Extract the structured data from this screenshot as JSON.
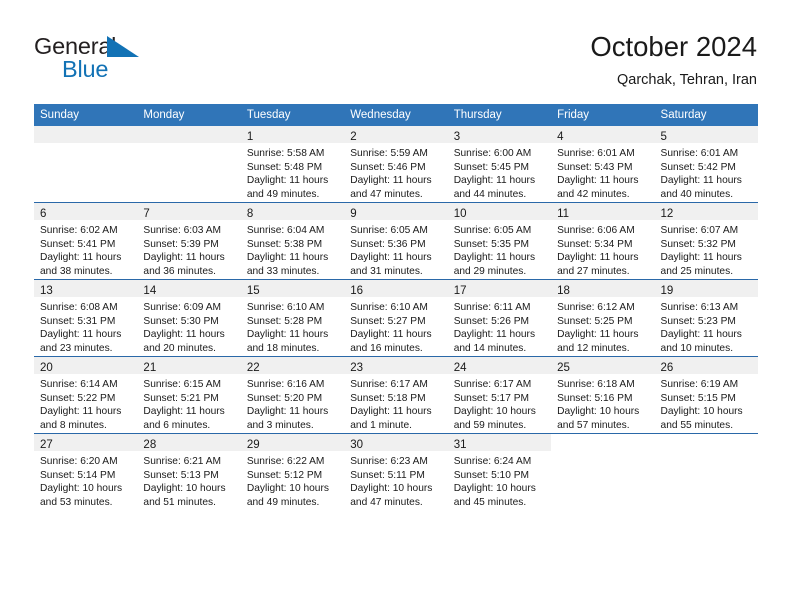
{
  "brand": {
    "name_top": "General",
    "name_bottom": "Blue",
    "accent_color": "#1272b5"
  },
  "header": {
    "title": "October 2024",
    "location": "Qarchak, Tehran, Iran"
  },
  "theme": {
    "header_blue": "#3075b8",
    "rule_blue": "#2a68a8",
    "daynum_strip": "#f0f0f0"
  },
  "calendar": {
    "weekday_headers": [
      "Sunday",
      "Monday",
      "Tuesday",
      "Wednesday",
      "Thursday",
      "Friday",
      "Saturday"
    ],
    "weeks": [
      [
        {
          "day": "",
          "lines": [],
          "empty": true
        },
        {
          "day": "",
          "lines": [],
          "empty": true
        },
        {
          "day": "1",
          "lines": [
            "Sunrise: 5:58 AM",
            "Sunset: 5:48 PM",
            "Daylight: 11 hours",
            "and 49 minutes."
          ]
        },
        {
          "day": "2",
          "lines": [
            "Sunrise: 5:59 AM",
            "Sunset: 5:46 PM",
            "Daylight: 11 hours",
            "and 47 minutes."
          ]
        },
        {
          "day": "3",
          "lines": [
            "Sunrise: 6:00 AM",
            "Sunset: 5:45 PM",
            "Daylight: 11 hours",
            "and 44 minutes."
          ]
        },
        {
          "day": "4",
          "lines": [
            "Sunrise: 6:01 AM",
            "Sunset: 5:43 PM",
            "Daylight: 11 hours",
            "and 42 minutes."
          ]
        },
        {
          "day": "5",
          "lines": [
            "Sunrise: 6:01 AM",
            "Sunset: 5:42 PM",
            "Daylight: 11 hours",
            "and 40 minutes."
          ]
        }
      ],
      [
        {
          "day": "6",
          "lines": [
            "Sunrise: 6:02 AM",
            "Sunset: 5:41 PM",
            "Daylight: 11 hours",
            "and 38 minutes."
          ]
        },
        {
          "day": "7",
          "lines": [
            "Sunrise: 6:03 AM",
            "Sunset: 5:39 PM",
            "Daylight: 11 hours",
            "and 36 minutes."
          ]
        },
        {
          "day": "8",
          "lines": [
            "Sunrise: 6:04 AM",
            "Sunset: 5:38 PM",
            "Daylight: 11 hours",
            "and 33 minutes."
          ]
        },
        {
          "day": "9",
          "lines": [
            "Sunrise: 6:05 AM",
            "Sunset: 5:36 PM",
            "Daylight: 11 hours",
            "and 31 minutes."
          ]
        },
        {
          "day": "10",
          "lines": [
            "Sunrise: 6:05 AM",
            "Sunset: 5:35 PM",
            "Daylight: 11 hours",
            "and 29 minutes."
          ]
        },
        {
          "day": "11",
          "lines": [
            "Sunrise: 6:06 AM",
            "Sunset: 5:34 PM",
            "Daylight: 11 hours",
            "and 27 minutes."
          ]
        },
        {
          "day": "12",
          "lines": [
            "Sunrise: 6:07 AM",
            "Sunset: 5:32 PM",
            "Daylight: 11 hours",
            "and 25 minutes."
          ]
        }
      ],
      [
        {
          "day": "13",
          "lines": [
            "Sunrise: 6:08 AM",
            "Sunset: 5:31 PM",
            "Daylight: 11 hours",
            "and 23 minutes."
          ]
        },
        {
          "day": "14",
          "lines": [
            "Sunrise: 6:09 AM",
            "Sunset: 5:30 PM",
            "Daylight: 11 hours",
            "and 20 minutes."
          ]
        },
        {
          "day": "15",
          "lines": [
            "Sunrise: 6:10 AM",
            "Sunset: 5:28 PM",
            "Daylight: 11 hours",
            "and 18 minutes."
          ]
        },
        {
          "day": "16",
          "lines": [
            "Sunrise: 6:10 AM",
            "Sunset: 5:27 PM",
            "Daylight: 11 hours",
            "and 16 minutes."
          ]
        },
        {
          "day": "17",
          "lines": [
            "Sunrise: 6:11 AM",
            "Sunset: 5:26 PM",
            "Daylight: 11 hours",
            "and 14 minutes."
          ]
        },
        {
          "day": "18",
          "lines": [
            "Sunrise: 6:12 AM",
            "Sunset: 5:25 PM",
            "Daylight: 11 hours",
            "and 12 minutes."
          ]
        },
        {
          "day": "19",
          "lines": [
            "Sunrise: 6:13 AM",
            "Sunset: 5:23 PM",
            "Daylight: 11 hours",
            "and 10 minutes."
          ]
        }
      ],
      [
        {
          "day": "20",
          "lines": [
            "Sunrise: 6:14 AM",
            "Sunset: 5:22 PM",
            "Daylight: 11 hours",
            "and 8 minutes."
          ]
        },
        {
          "day": "21",
          "lines": [
            "Sunrise: 6:15 AM",
            "Sunset: 5:21 PM",
            "Daylight: 11 hours",
            "and 6 minutes."
          ]
        },
        {
          "day": "22",
          "lines": [
            "Sunrise: 6:16 AM",
            "Sunset: 5:20 PM",
            "Daylight: 11 hours",
            "and 3 minutes."
          ]
        },
        {
          "day": "23",
          "lines": [
            "Sunrise: 6:17 AM",
            "Sunset: 5:18 PM",
            "Daylight: 11 hours",
            "and 1 minute."
          ]
        },
        {
          "day": "24",
          "lines": [
            "Sunrise: 6:17 AM",
            "Sunset: 5:17 PM",
            "Daylight: 10 hours",
            "and 59 minutes."
          ]
        },
        {
          "day": "25",
          "lines": [
            "Sunrise: 6:18 AM",
            "Sunset: 5:16 PM",
            "Daylight: 10 hours",
            "and 57 minutes."
          ]
        },
        {
          "day": "26",
          "lines": [
            "Sunrise: 6:19 AM",
            "Sunset: 5:15 PM",
            "Daylight: 10 hours",
            "and 55 minutes."
          ]
        }
      ],
      [
        {
          "day": "27",
          "lines": [
            "Sunrise: 6:20 AM",
            "Sunset: 5:14 PM",
            "Daylight: 10 hours",
            "and 53 minutes."
          ]
        },
        {
          "day": "28",
          "lines": [
            "Sunrise: 6:21 AM",
            "Sunset: 5:13 PM",
            "Daylight: 10 hours",
            "and 51 minutes."
          ]
        },
        {
          "day": "29",
          "lines": [
            "Sunrise: 6:22 AM",
            "Sunset: 5:12 PM",
            "Daylight: 10 hours",
            "and 49 minutes."
          ]
        },
        {
          "day": "30",
          "lines": [
            "Sunrise: 6:23 AM",
            "Sunset: 5:11 PM",
            "Daylight: 10 hours",
            "and 47 minutes."
          ]
        },
        {
          "day": "31",
          "lines": [
            "Sunrise: 6:24 AM",
            "Sunset: 5:10 PM",
            "Daylight: 10 hours",
            "and 45 minutes."
          ]
        },
        {
          "day": "",
          "lines": [],
          "blank": true
        },
        {
          "day": "",
          "lines": [],
          "blank": true
        }
      ]
    ]
  }
}
